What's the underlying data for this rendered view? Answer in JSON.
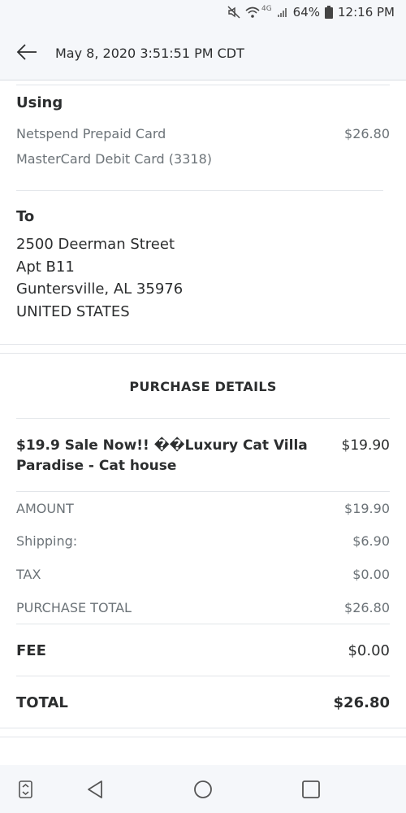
{
  "status_bar": {
    "network": "4G",
    "battery": "64%",
    "time": "12:16 PM"
  },
  "header": {
    "title": "May 8, 2020 3:51:51 PM CDT"
  },
  "using": {
    "title": "Using",
    "source_name": "Netspend Prepaid Card",
    "source_amount": "$26.80",
    "card": "MasterCard Debit Card (3318)"
  },
  "to": {
    "title": "To",
    "address_lines": [
      "2500 Deerman Street",
      "Apt B11",
      "Guntersville, AL 35976",
      "UNITED STATES"
    ]
  },
  "purchase": {
    "heading": "PURCHASE DETAILS",
    "item_name": "$19.9 Sale Now!! ��Luxury Cat Villa Paradise - Cat house",
    "item_price": "$19.90",
    "rows": [
      {
        "label": "AMOUNT",
        "value": "$19.90"
      },
      {
        "label": "Shipping:",
        "value": "$6.90"
      },
      {
        "label": "TAX",
        "value": "$0.00"
      },
      {
        "label": "PURCHASE TOTAL",
        "value": "$26.80"
      }
    ],
    "fee_label": "FEE",
    "fee_value": "$0.00",
    "total_label": "TOTAL",
    "total_value": "$26.80"
  }
}
